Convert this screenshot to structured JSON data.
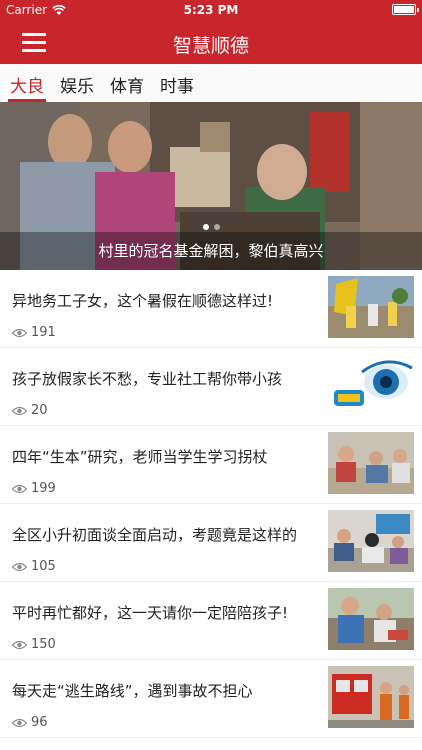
{
  "status_bar": {
    "carrier": "Carrier",
    "time": "5:23 PM",
    "battery_level": 1.0
  },
  "navbar": {
    "title": "智慧顺德"
  },
  "tabs": [
    {
      "label": "大良",
      "active": true
    },
    {
      "label": "娱乐",
      "active": false
    },
    {
      "label": "体育",
      "active": false
    },
    {
      "label": "时事",
      "active": false
    }
  ],
  "hero": {
    "caption": "村里的冠名基金解困，黎伯真高兴",
    "slide_count": 2,
    "active_slide": 1
  },
  "articles": [
    {
      "title": "异地务工子女，这个暑假在顺德这样过!",
      "views": "191"
    },
    {
      "title": "孩子放假家长不愁，专业社工帮你带小孩",
      "views": "20"
    },
    {
      "title": "四年“生本”研究，老师当学生学习拐杖",
      "views": "199"
    },
    {
      "title": "全区小升初面谈全面启动，考题竟是这样的",
      "views": "105"
    },
    {
      "title": "平时再忙都好，这一天请你一定陪陪孩子!",
      "views": "150"
    },
    {
      "title": "每天走“逃生路线”，遇到事故不担心",
      "views": "96"
    }
  ],
  "icons": {
    "menu": "hamburger-icon",
    "views": "eye-icon",
    "wifi": "wifi-icon",
    "battery": "battery-icon"
  },
  "colors": {
    "brand_red": "#c9252c"
  }
}
